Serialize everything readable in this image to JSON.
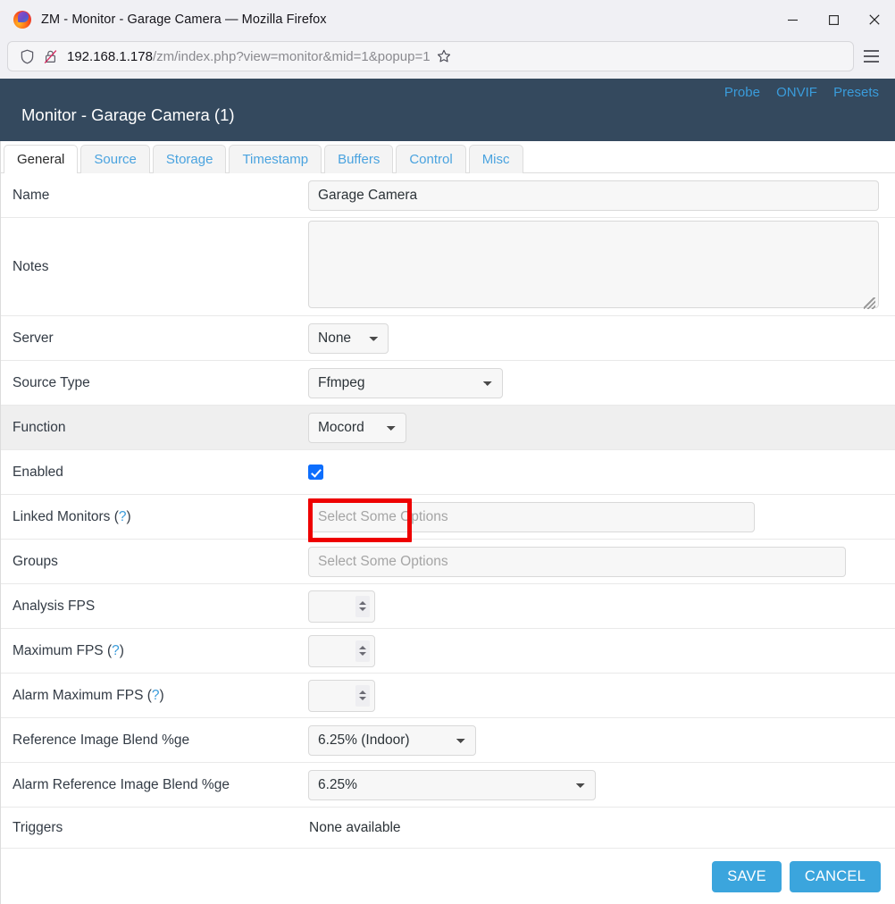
{
  "browser": {
    "window_title": "ZM - Monitor - Garage Camera — Mozilla Firefox",
    "minimize_label": "Minimize",
    "maximize_label": "Maximize",
    "close_label": "Close",
    "url_host": "192.168.1.178",
    "url_path": "/zm/index.php?view=monitor&mid=1&popup=1",
    "bookmark_label": "Bookmark this page",
    "menu_label": "Open application menu"
  },
  "header": {
    "title": "Monitor - Garage Camera (1)",
    "links": [
      {
        "label": "Probe"
      },
      {
        "label": "ONVIF"
      },
      {
        "label": "Presets"
      }
    ],
    "bg_color": "#34495e",
    "link_color": "#3a9cdb"
  },
  "tabs": [
    {
      "label": "General",
      "active": true
    },
    {
      "label": "Source",
      "active": false
    },
    {
      "label": "Storage",
      "active": false
    },
    {
      "label": "Timestamp",
      "active": false
    },
    {
      "label": "Buffers",
      "active": false
    },
    {
      "label": "Control",
      "active": false
    },
    {
      "label": "Misc",
      "active": false
    }
  ],
  "form": {
    "name": {
      "label": "Name",
      "value": "Garage Camera"
    },
    "notes": {
      "label": "Notes",
      "value": ""
    },
    "server": {
      "label": "Server",
      "value": "None"
    },
    "source_type": {
      "label": "Source Type",
      "value": "Ffmpeg"
    },
    "function": {
      "label": "Function",
      "value": "Mocord",
      "highlighted": true
    },
    "enabled": {
      "label": "Enabled",
      "checked": true
    },
    "linked_monitors": {
      "label": "Linked Monitors",
      "help": "(?)",
      "placeholder": "Select Some Options",
      "value": ""
    },
    "groups": {
      "label": "Groups",
      "placeholder": "Select Some Options",
      "value": ""
    },
    "analysis_fps": {
      "label": "Analysis FPS",
      "value": ""
    },
    "maximum_fps": {
      "label": "Maximum FPS",
      "help": "(?)",
      "value": ""
    },
    "alarm_maximum_fps": {
      "label": "Alarm Maximum FPS",
      "help": "(?)",
      "value": ""
    },
    "reference_image_blend": {
      "label": "Reference Image Blend %ge",
      "value": "6.25% (Indoor)"
    },
    "alarm_reference_image_blend": {
      "label": "Alarm Reference Image Blend %ge",
      "value": "6.25%"
    },
    "triggers": {
      "label": "Triggers",
      "value": "None available"
    }
  },
  "footer": {
    "save_label": "SAVE",
    "cancel_label": "CANCEL",
    "button_color": "#3ba5dd"
  },
  "annotation": {
    "highlight_color": "#ee0000",
    "target": "Function"
  }
}
